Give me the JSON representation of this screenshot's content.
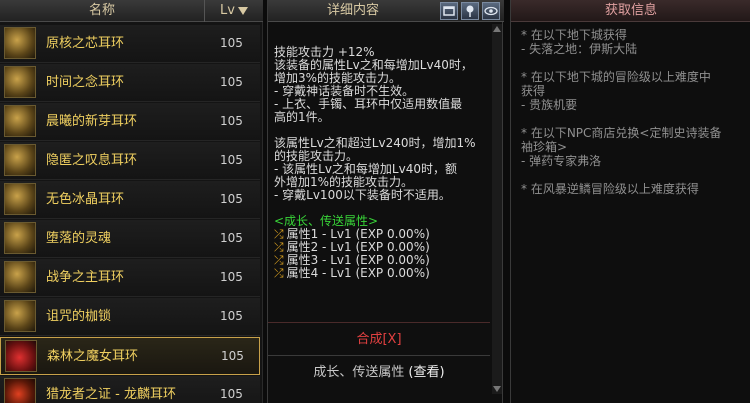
{
  "list": {
    "header_name": "名称",
    "header_lv": "Lv",
    "items": [
      {
        "name": "原核之芯耳环",
        "lv": "105"
      },
      {
        "name": "时间之念耳环",
        "lv": "105"
      },
      {
        "name": "晨曦的新芽耳环",
        "lv": "105"
      },
      {
        "name": "隐匿之叹息耳环",
        "lv": "105"
      },
      {
        "name": "无色冰晶耳环",
        "lv": "105"
      },
      {
        "name": "堕落的灵魂",
        "lv": "105"
      },
      {
        "name": "战争之主耳环",
        "lv": "105"
      },
      {
        "name": "诅咒的枷锁",
        "lv": "105"
      },
      {
        "name": "森林之魔女耳环",
        "lv": "105"
      },
      {
        "name": "猎龙者之证 - 龙麟耳环",
        "lv": "105"
      }
    ]
  },
  "detail": {
    "title": "详细内容",
    "lines": [
      "技能攻击力 +12%",
      "该装备的属性Lv之和每增加Lv40时，",
      "增加3%的技能攻击力。",
      "- 穿戴神话装备时不生效。",
      "- 上衣、手镯、耳环中仅适用数值最",
      "高的1件。",
      "",
      "该属性Lv之和超过Lv240时，增加1%",
      "的技能攻击力。",
      "- 该属性Lv之和每增加Lv40时，额",
      "外增加1%的技能攻击力。",
      "- 穿戴Lv100以下装备时不适用。",
      ""
    ],
    "growth_title": "<成长、传送属性>",
    "attrs": [
      "属性1 - Lv1 (EXP 0.00%)",
      "属性2 - Lv1 (EXP 0.00%)",
      "属性3 - Lv1 (EXP 0.00%)",
      "属性4 - Lv1 (EXP 0.00%)"
    ],
    "merge_label": "合成[X]",
    "footer_text": "成长、传送属性",
    "footer_link": "(查看)"
  },
  "sources": {
    "title": "获取信息",
    "lines": [
      "* 在以下地下城获得",
      "- 失落之地：伊斯大陆",
      "",
      "* 在以下地下城的冒险级以上难度中",
      "获得",
      "- 贵族机要",
      "",
      "* 在以下NPC商店兑换<定制史诗装备",
      "袖珍箱>",
      "- 弹药专家弗洛",
      "",
      "* 在风暴逆鳞冒险级以上难度获得"
    ]
  },
  "colors": {
    "item_name": "#f0d060",
    "growth_title": "#38d438",
    "merge": "#e04040",
    "selected_border": "#c8a14a"
  },
  "icons": {
    "detail_buttons": [
      "window-icon",
      "pin-icon",
      "eye-icon"
    ],
    "attr_marker": "shuffle-icon"
  }
}
